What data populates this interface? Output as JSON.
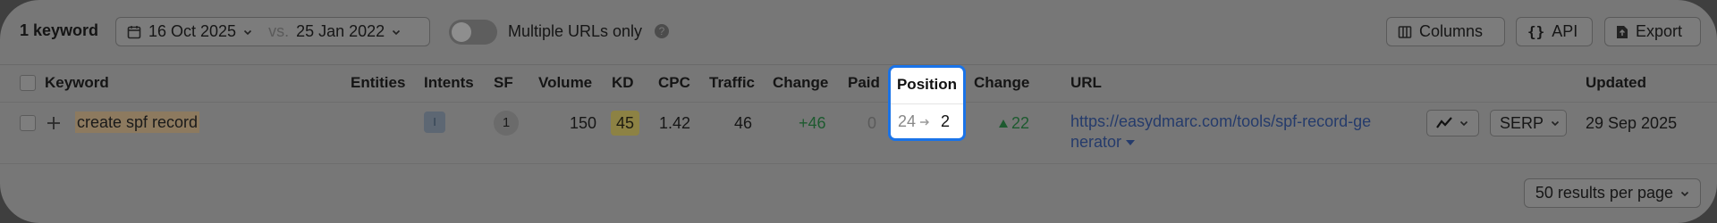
{
  "toolbar": {
    "keyword_count": "1 keyword",
    "date_current": "16 Oct 2025",
    "vs_label": "vs.",
    "date_compare": "25 Jan 2022",
    "toggle_label": "Multiple URLs only",
    "help_glyph": "?",
    "columns_label": "Columns",
    "api_label": "API",
    "export_label": "Export"
  },
  "table": {
    "headers": {
      "keyword": "Keyword",
      "entities": "Entities",
      "intents": "Intents",
      "sf": "SF",
      "volume": "Volume",
      "kd": "KD",
      "cpc": "CPC",
      "traffic": "Traffic",
      "change": "Change",
      "paid": "Paid",
      "position": "Position",
      "position_change": "Change",
      "url": "URL",
      "updated": "Updated"
    },
    "row": {
      "keyword": "create spf record",
      "intent": "I",
      "sf": "1",
      "volume": "150",
      "kd": "45",
      "cpc": "1.42",
      "traffic": "46",
      "traffic_change": "+46",
      "paid": "0",
      "position_from": "24",
      "position_to": "2",
      "position_change": "22",
      "url_line1": "https://easydmarc.com/tools/spf-record-ge",
      "url_line2": "nerator",
      "serp_label": "SERP",
      "updated": "29 Sep 2025"
    }
  },
  "footer": {
    "per_page_label": "50 results per page"
  },
  "colors": {
    "highlight_border": "#1a73e8",
    "positive_change": "#1d5a2f",
    "link": "#253b6b"
  },
  "icons": {
    "calendar": "calendar-icon",
    "chevron": "chevron-down-icon",
    "columns": "columns-icon",
    "api": "braces-icon",
    "export": "export-icon",
    "plus": "plus-icon",
    "arrow": "arrow-right-icon",
    "triangle": "triangle-up-icon",
    "trend": "trend-chart-icon"
  }
}
